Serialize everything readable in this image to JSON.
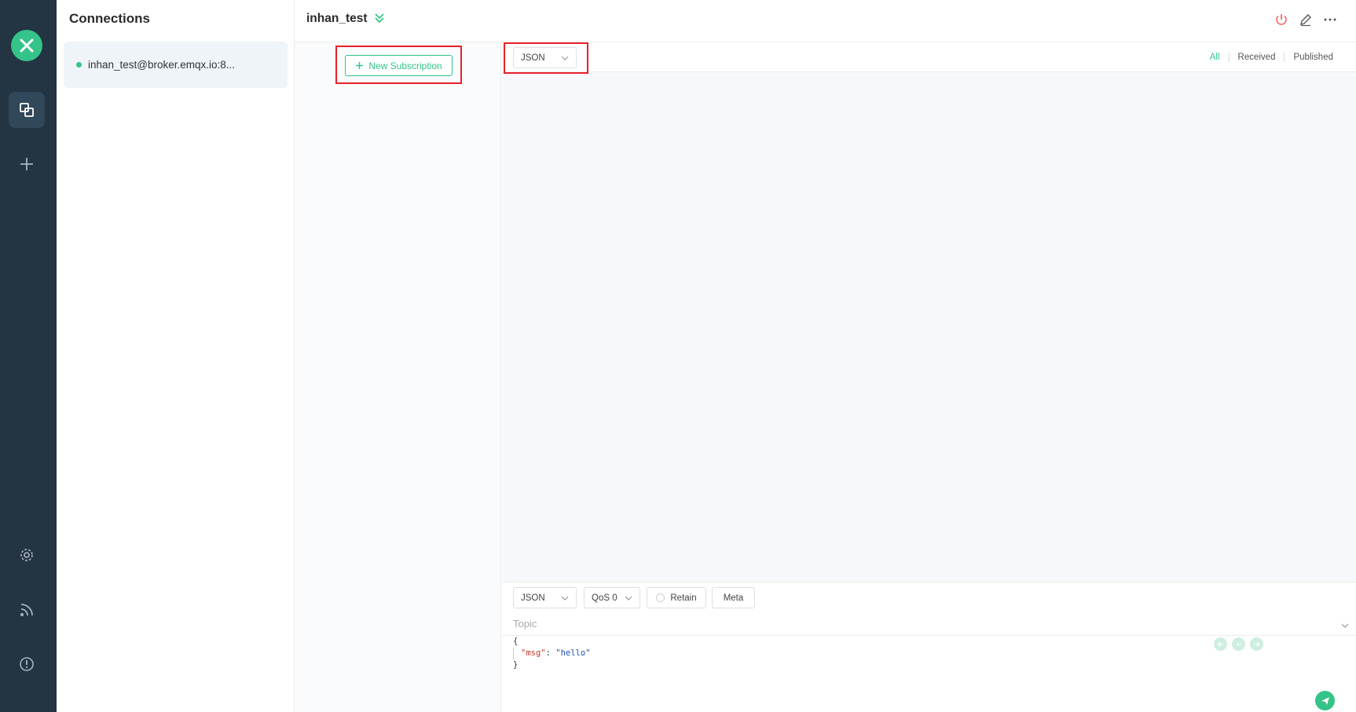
{
  "sidebar": {
    "nav": [
      {
        "name": "connections",
        "icon": "connections-icon"
      },
      {
        "name": "new-connection",
        "icon": "plus-icon"
      },
      {
        "name": "settings",
        "icon": "gear-icon"
      },
      {
        "name": "log",
        "icon": "rss-icon"
      },
      {
        "name": "about",
        "icon": "info-icon"
      }
    ]
  },
  "connections": {
    "title": "Connections",
    "items": [
      {
        "label": "inhan_test@broker.emqx.io:8...",
        "status": "connected",
        "status_color": "#34c388"
      }
    ]
  },
  "header": {
    "connection_name": "inhan_test",
    "icons": [
      "double-chevron-down-icon",
      "power-icon",
      "edit-icon",
      "more-icon"
    ]
  },
  "subscriptions": {
    "new_button_label": "New Subscription"
  },
  "messages": {
    "payload_format": "JSON",
    "filters": [
      "All",
      "Received",
      "Published"
    ],
    "active_filter": "All"
  },
  "publish": {
    "payload_format": "JSON",
    "qos": "QoS 0",
    "retain_label": "Retain",
    "meta_label": "Meta",
    "topic_placeholder": "Topic",
    "payload_lines": [
      "{",
      "\"msg\": \"hello\"",
      "}"
    ],
    "payload_key": "\"msg\"",
    "payload_value": "\"hello\""
  },
  "colors": {
    "accent": "#34c388",
    "sidebar_bg": "#233443",
    "highlight": "#e8202a"
  }
}
